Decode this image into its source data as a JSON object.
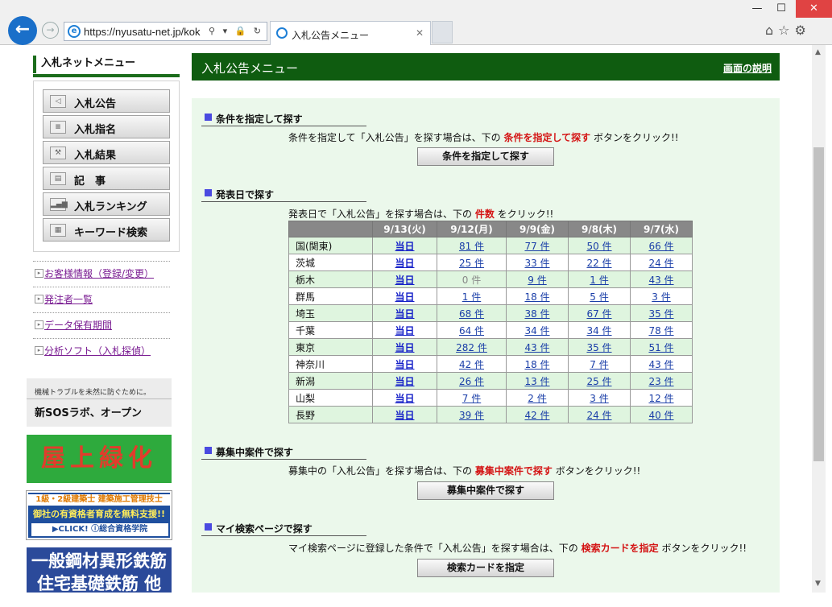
{
  "browser": {
    "url": "https://nyusatu-net.jp/kok",
    "tab_title": "入札公告メニュー",
    "address_controls": "⚲ ▾ 🔒 ↻",
    "tools_icons": "⌂☆⚙"
  },
  "sidebar": {
    "title": "入札ネットメニュー",
    "buttons": [
      {
        "label": "入札公告",
        "icon": "megaphone-icon"
      },
      {
        "label": "入札指名",
        "icon": "list-icon"
      },
      {
        "label": "入札結果",
        "icon": "gavel-icon"
      },
      {
        "label": "記　事",
        "icon": "document-icon"
      },
      {
        "label": "入札ランキング",
        "icon": "bar-chart-icon"
      },
      {
        "label": "キーワード検索",
        "icon": "keyboard-icon"
      }
    ],
    "links": [
      "お客様情報（登録/変更）",
      "発注者一覧",
      "データ保有期間",
      "分析ソフト（入札探偵）"
    ],
    "ads": {
      "ad1_small": "機械トラブルを未然に防ぐために。",
      "ad1_big": "新SOSラボ、オープン",
      "ad2": "屋上緑化",
      "ad3_top": "1級・2級建築士 建築施工管理技士",
      "ad3_mid": "御社の有資格者育成を無料支援!!",
      "ad3_bottom": "▶CLICK! ⓘ総合資格学院",
      "ad4_line1": "一般鋼材異形鉄筋",
      "ad4_line2": "住宅基礎鉄筋 他"
    }
  },
  "main": {
    "title": "入札公告メニュー",
    "help_link": "画面の説明",
    "section1": {
      "heading": "条件を指定して探す",
      "desc_pre": "条件を指定して「入札公告」を探す場合は、下の",
      "desc_red": "条件を指定して探す",
      "desc_post": "ボタンをクリック!!",
      "button": "条件を指定して探す"
    },
    "section2": {
      "heading": "発表日で探す",
      "desc_pre": "発表日で「入札公告」を探す場合は、下の",
      "desc_red": "件数",
      "desc_post": "をクリック!!",
      "columns": [
        "",
        "9/13(火)",
        "9/12(月)",
        "9/9(金)",
        "9/8(木)",
        "9/7(水)"
      ],
      "today_label": "当日",
      "rows": [
        {
          "pref": "国(関東)",
          "c": [
            "81 件",
            "77 件",
            "50 件",
            "66 件"
          ]
        },
        {
          "pref": "茨城",
          "c": [
            "25 件",
            "33 件",
            "22 件",
            "24 件"
          ]
        },
        {
          "pref": "栃木",
          "c": [
            "0 件",
            "9 件",
            "1 件",
            "43 件"
          ]
        },
        {
          "pref": "群馬",
          "c": [
            "1 件",
            "18 件",
            "5 件",
            "3 件"
          ]
        },
        {
          "pref": "埼玉",
          "c": [
            "68 件",
            "38 件",
            "67 件",
            "35 件"
          ]
        },
        {
          "pref": "千葉",
          "c": [
            "64 件",
            "34 件",
            "34 件",
            "78 件"
          ]
        },
        {
          "pref": "東京",
          "c": [
            "282 件",
            "43 件",
            "35 件",
            "51 件"
          ]
        },
        {
          "pref": "神奈川",
          "c": [
            "42 件",
            "18 件",
            "7 件",
            "43 件"
          ]
        },
        {
          "pref": "新潟",
          "c": [
            "26 件",
            "13 件",
            "25 件",
            "23 件"
          ]
        },
        {
          "pref": "山梨",
          "c": [
            "7 件",
            "2 件",
            "3 件",
            "12 件"
          ]
        },
        {
          "pref": "長野",
          "c": [
            "39 件",
            "42 件",
            "24 件",
            "40 件"
          ]
        }
      ]
    },
    "section3": {
      "heading": "募集中案件で探す",
      "desc_pre": "募集中の「入札公告」を探す場合は、下の",
      "desc_red": "募集中案件で探す",
      "desc_post": "ボタンをクリック!!",
      "button": "募集中案件で探す"
    },
    "section4": {
      "heading": "マイ検索ページで探す",
      "desc_pre": "マイ検索ページに登録した条件で「入札公告」を探す場合は、下の",
      "desc_red": "検索カードを指定",
      "desc_post": "ボタンをクリック!!",
      "button": "検索カードを指定"
    }
  }
}
